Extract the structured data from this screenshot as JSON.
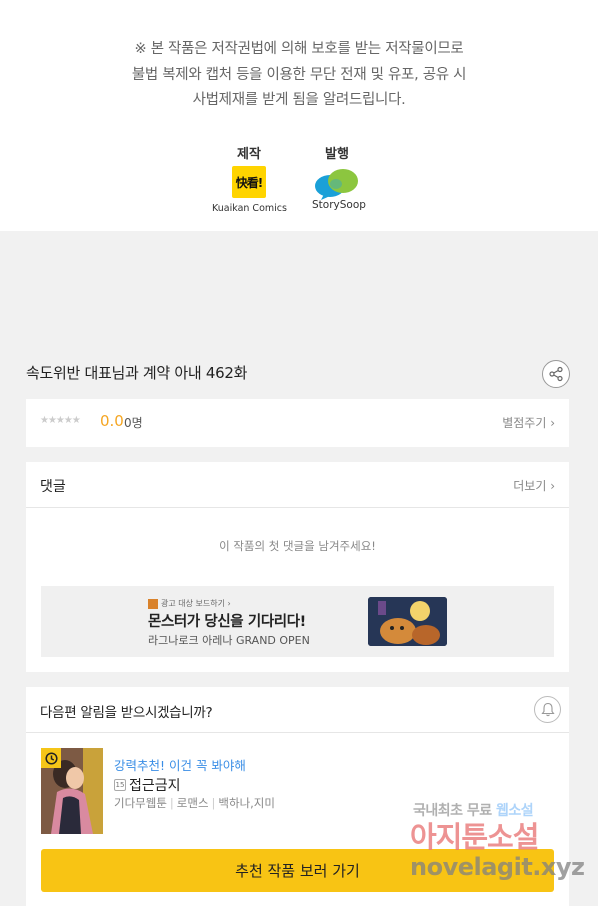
{
  "copyright_notice": {
    "line1": "※ 본 작품은 저작권법에 의해 보호를 받는 저작물이므로",
    "line2": "불법 복제와 캡처 등을  이용한 무단 전재 및 유포, 공유 시",
    "line3": "사법제재를  받게 됨을 알려드립니다."
  },
  "production": {
    "label": "제작",
    "logo_text": "快看!",
    "name": "Kuaikan Comics"
  },
  "publisher": {
    "label": "발행",
    "name": "StorySoop"
  },
  "episode": {
    "title": "속도위반 대표님과 계약 아내 462화"
  },
  "rating": {
    "stars": "★★★★★",
    "score": "0.0",
    "count": "0명",
    "rate_link": "별점주기 ›"
  },
  "comments": {
    "heading": "댓글",
    "more_link": "더보기 ›",
    "empty_message": "이 작품의 첫 댓글을 남겨주세요!"
  },
  "ad": {
    "small_text": "광고 대상 보드하기 ›",
    "title": "몬스터가 당신을 기다리다!",
    "subtitle": "라그나로크 아레나 GRAND OPEN"
  },
  "notify": {
    "question": "다음편 알림을 받으시겠습니까?"
  },
  "recommendation": {
    "label": "강력추천! 이건 꼭 봐야해",
    "age_badge": "15",
    "title": "접근금지",
    "genre": "기다무웹툰",
    "category": "로맨스",
    "authors": "백하나,지미",
    "cta": "추천 작품 보러 가기"
  },
  "watermark": {
    "line1_prefix": "국내최초 무료 ",
    "line1_highlight": "웹소설",
    "line2": "아지툰소설",
    "line3": "novelagit.xyz"
  },
  "colors": {
    "accent_yellow": "#f8c414",
    "score_orange": "#f5a623",
    "link_blue": "#3a8ee6"
  }
}
